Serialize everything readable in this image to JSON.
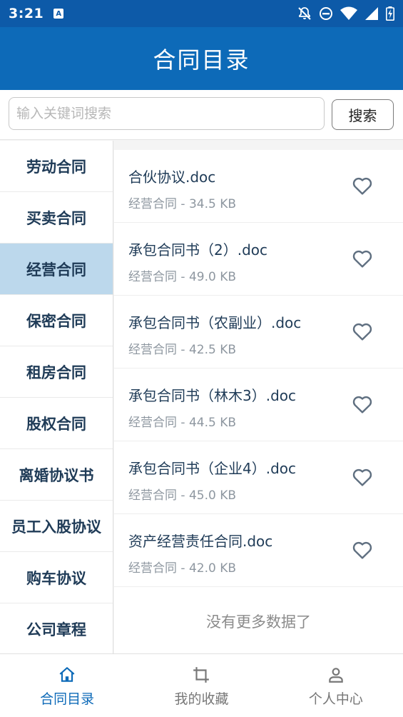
{
  "status": {
    "time": "3:21"
  },
  "header": {
    "title": "合同目录"
  },
  "search": {
    "placeholder": "输入关键词搜索",
    "button_label": "搜索"
  },
  "sidebar": {
    "items": [
      {
        "label": "劳动合同"
      },
      {
        "label": "买卖合同"
      },
      {
        "label": "经营合同"
      },
      {
        "label": "保密合同"
      },
      {
        "label": "租房合同"
      },
      {
        "label": "股权合同"
      },
      {
        "label": "离婚协议书"
      },
      {
        "label": "员工入股协议"
      },
      {
        "label": "购车协议"
      },
      {
        "label": "公司章程"
      }
    ],
    "selected": "经营合同"
  },
  "documents": [
    {
      "name": "合伙协议.doc",
      "meta": "经营合同 - 34.5 KB"
    },
    {
      "name": "承包合同书（2）.doc",
      "meta": "经营合同 - 49.0 KB"
    },
    {
      "name": "承包合同书（农副业）.doc",
      "meta": "经营合同 - 42.5 KB"
    },
    {
      "name": "承包合同书（林木3）.doc",
      "meta": "经营合同 - 44.5 KB"
    },
    {
      "name": "承包合同书（企业4）.doc",
      "meta": "经营合同 - 45.0 KB"
    },
    {
      "name": "资产经营责任合同.doc",
      "meta": "经营合同 - 42.0 KB"
    }
  ],
  "list_footer": "没有更多数据了",
  "bottom_nav": [
    {
      "label": "合同目录",
      "icon": "home-icon"
    },
    {
      "label": "我的收藏",
      "icon": "crop-icon"
    },
    {
      "label": "个人中心",
      "icon": "person-icon"
    }
  ],
  "colors": {
    "primary": "#0d6ab8",
    "status_bar": "#0d5aa8",
    "selected_bg": "#bcd8ec",
    "heart": "#5f6f80"
  }
}
